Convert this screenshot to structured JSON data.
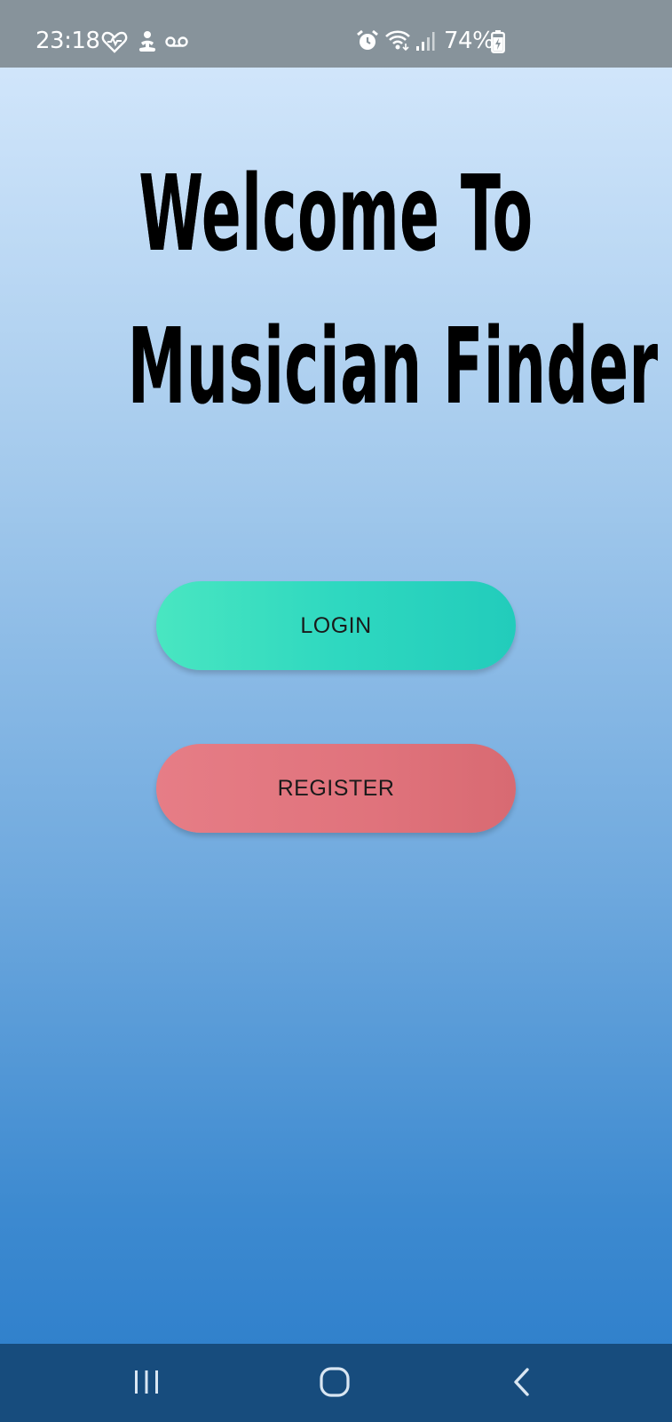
{
  "status_bar": {
    "time": "23:18",
    "battery": "74%",
    "icons": [
      "health-heart-icon",
      "meditation-icon",
      "voicemail-icon",
      "alarm-icon",
      "wifi-icon",
      "signal-icon",
      "battery-charging-icon"
    ]
  },
  "title": {
    "line1": "Welcome To",
    "line2": "Musician Finder"
  },
  "buttons": {
    "login": "LOGIN",
    "register": "REGISTER"
  },
  "colors": {
    "login_button": "#2fd8c0",
    "register_button": "#e0737c",
    "status_bar": "#87939b",
    "nav_bar": "#174c7d"
  },
  "nav_bar": {
    "icons": [
      "recent-apps-icon",
      "home-icon",
      "back-icon"
    ]
  }
}
